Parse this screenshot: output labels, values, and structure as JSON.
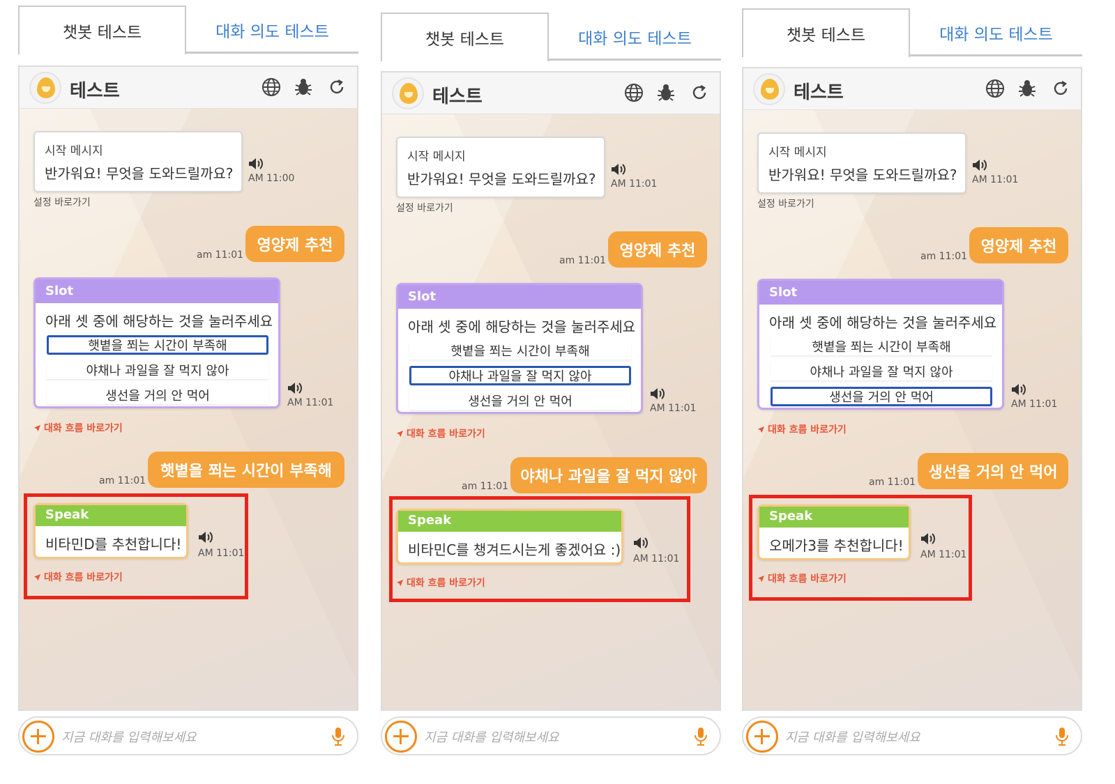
{
  "tabs": {
    "chatbot": "챗봇 테스트",
    "intent": "대화 의도 테스트"
  },
  "header_title": "테스트",
  "start": {
    "label": "시작 메시지",
    "message": "반가워요! 무엇을 도와드릴까요?",
    "settings_link": "설정 바로가기"
  },
  "user_request": "영양제 추천",
  "slot": {
    "tag": "Slot",
    "prompt": "아래 셋 중에 해당하는 것을 눌러주세요",
    "options": [
      "햇볕을 쬐는 시간이 부족해",
      "야채나 과일을 잘 먹지 않아",
      "생선을 거의 안 먹어"
    ]
  },
  "flow_link": "대화 흐름 바로가기",
  "speak_tag": "Speak",
  "input_placeholder": "지금 대화를 입력해보세요",
  "accent_colors": {
    "user_bubble": "#f5a33c",
    "slot_bar": "#b79aee",
    "speak_bar": "#8ccb46",
    "highlight_box": "#e8241b",
    "tab_active_text": "#3d7fd1"
  },
  "panels": [
    {
      "start_time": "AM 11:00",
      "user_time": "am 11:01",
      "slot_time": "AM 11:01",
      "selected": 0,
      "reply": "햇볕을 쬐는 시간이 부족해",
      "reply_time": "am 11:01",
      "speak_message": "비타민D를 추천합니다!",
      "speak_time": "AM 11:01"
    },
    {
      "start_time": "AM 11:01",
      "user_time": "am 11:01",
      "slot_time": "AM 11:01",
      "selected": 1,
      "reply": "야채나 과일을 잘 먹지 않아",
      "reply_time": "am 11:01",
      "speak_message": "비타민C를 챙겨드시는게 좋겠어요 :)",
      "speak_time": "AM 11:01"
    },
    {
      "start_time": "AM 11:01",
      "user_time": "am 11:01",
      "slot_time": "AM 11:01",
      "selected": 2,
      "reply": "생선을 거의 안 먹어",
      "reply_time": "am 11:01",
      "speak_message": "오메가3를 추천합니다!",
      "speak_time": "AM 11:01"
    }
  ]
}
